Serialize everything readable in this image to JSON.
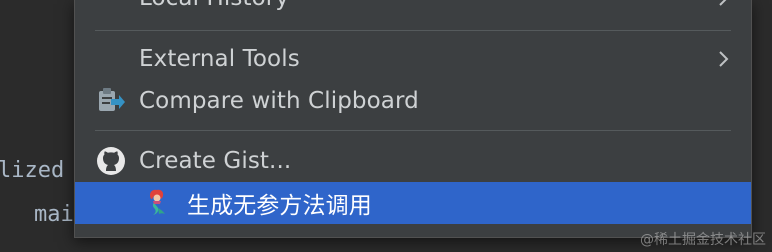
{
  "editor": {
    "code_line_1": "lized",
    "code_line_2": "mai"
  },
  "menu": {
    "items": [
      {
        "label": "Local History",
        "icon": "",
        "has_submenu": true
      },
      {
        "label": "External Tools",
        "icon": "",
        "has_submenu": true
      },
      {
        "label": "Compare with Clipboard",
        "icon": "compare-clipboard-icon",
        "has_submenu": false
      },
      {
        "label": "Create Gist...",
        "icon": "github-icon",
        "has_submenu": false
      },
      {
        "label": "生成无参方法调用",
        "icon": "mermaid-plugin-icon",
        "has_submenu": false,
        "selected": true
      }
    ]
  },
  "watermark": "@稀土掘金技术社区",
  "colors": {
    "menu_bg": "#3c3f41",
    "selection": "#2f65ca",
    "text": "#cfd2d4",
    "editor_bg": "#2b2b2b"
  }
}
